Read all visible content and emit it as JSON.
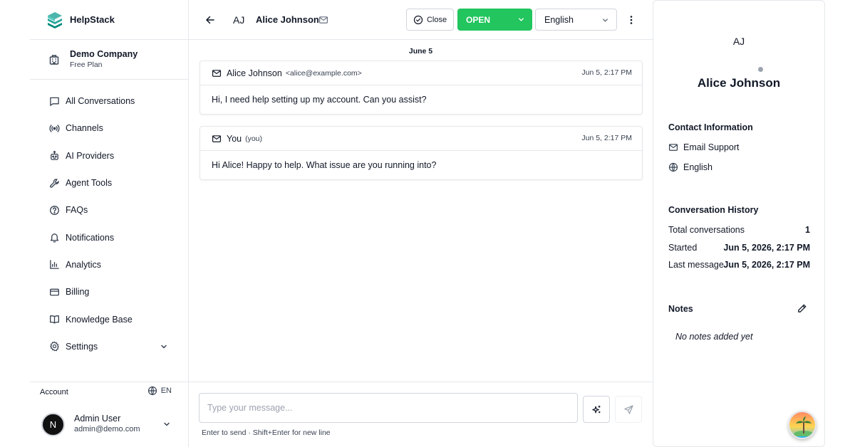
{
  "brand": {
    "name": "HelpStack"
  },
  "company": {
    "name": "Demo Company",
    "plan": "Free Plan"
  },
  "nav": {
    "items": [
      {
        "label": "All Conversations",
        "icon": "chat-icon"
      },
      {
        "label": "Channels",
        "icon": "broadcast-icon"
      },
      {
        "label": "AI Providers",
        "icon": "robot-icon"
      },
      {
        "label": "Agent Tools",
        "icon": "wrench-icon"
      },
      {
        "label": "FAQs",
        "icon": "help-circle-icon"
      },
      {
        "label": "Notifications",
        "icon": "bell-icon"
      },
      {
        "label": "Analytics",
        "icon": "bar-chart-icon"
      },
      {
        "label": "Billing",
        "icon": "credit-card-icon"
      },
      {
        "label": "Knowledge Base",
        "icon": "book-icon"
      },
      {
        "label": "Settings",
        "icon": "gear-icon"
      }
    ]
  },
  "account": {
    "label": "Account",
    "lang": "EN",
    "avatar_letter": "N",
    "user_name": "Admin User",
    "user_email": "admin@demo.com"
  },
  "header": {
    "initials": "AJ",
    "name": "Alice Johnson",
    "close_label": "Close",
    "status": "OPEN",
    "language": "English",
    "status_color": "#22c55e"
  },
  "thread": {
    "date": "June 5",
    "messages": [
      {
        "sender": "Alice Johnson",
        "email": "<alice@example.com>",
        "time": "Jun 5, 2:17 PM",
        "body": "Hi, I need help setting up my account. Can you assist?"
      },
      {
        "sender": "You",
        "email": "(you)",
        "time": "Jun 5, 2:17 PM",
        "body": "Hi Alice! Happy to help. What issue are you running into?"
      }
    ]
  },
  "composer": {
    "placeholder": "Type your message...",
    "hint": "Enter to send · Shift+Enter for new line"
  },
  "contact": {
    "initials": "AJ",
    "name": "Alice Johnson",
    "info_title": "Contact Information",
    "channel": "Email Support",
    "language": "English",
    "history_title": "Conversation History",
    "history": [
      {
        "label": "Total conversations",
        "value": "1"
      },
      {
        "label": "Started",
        "value": "Jun 5, 2026, 2:17 PM"
      },
      {
        "label": "Last message",
        "value": "Jun 5, 2026, 2:17 PM"
      }
    ],
    "notes_title": "Notes",
    "notes_empty": "No notes added yet"
  }
}
